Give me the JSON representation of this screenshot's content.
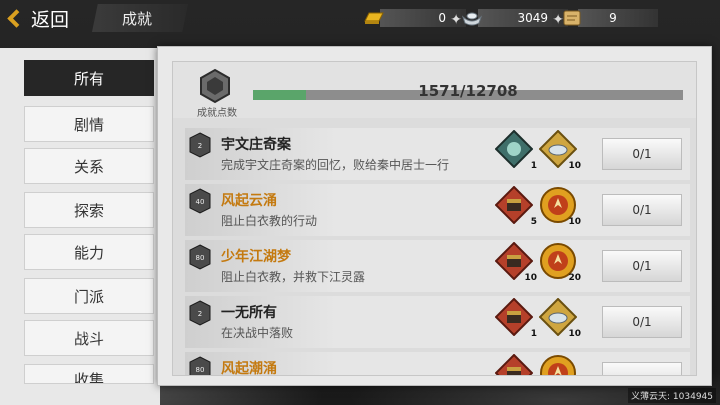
{
  "header": {
    "back_label": "返回",
    "title": "成就"
  },
  "currencies": [
    {
      "icon": "gold-ingot-icon",
      "value": "0"
    },
    {
      "icon": "silver-ingot-icon",
      "value": "3049"
    },
    {
      "icon": "scroll-icon",
      "value": "9"
    }
  ],
  "sidebar": {
    "items": [
      {
        "label": "所有",
        "active": true
      },
      {
        "label": "剧情"
      },
      {
        "label": "关系"
      },
      {
        "label": "探索"
      },
      {
        "label": "能力"
      },
      {
        "label": "门派"
      },
      {
        "label": "战斗"
      },
      {
        "label": "收集"
      }
    ]
  },
  "progress": {
    "label": "成就点数",
    "text": "1571/12708",
    "value": 1571,
    "max": 12708
  },
  "achievements": [
    {
      "level": "2",
      "title": "宇文庄奇案",
      "title_color": "#222222",
      "desc": "完成宇文庄奇案的回忆，败给秦中居士一行",
      "rewards": [
        {
          "icon": "teal-gem-icon",
          "count": "1"
        },
        {
          "icon": "silver-ingot-reward-icon",
          "count": "10"
        }
      ],
      "status": "0/1"
    },
    {
      "level": "40",
      "title": "风起云涌",
      "title_color": "#c47a10",
      "desc": "阻止白衣教的行动",
      "rewards": [
        {
          "icon": "red-chest-icon",
          "count": "5"
        },
        {
          "icon": "gold-coin-icon",
          "count": "10"
        }
      ],
      "status": "0/1"
    },
    {
      "level": "80",
      "title": "少年江湖梦",
      "title_color": "#c47a10",
      "desc": "阻止白衣教，并救下江灵露",
      "rewards": [
        {
          "icon": "red-chest-icon",
          "count": "10"
        },
        {
          "icon": "gold-coin-icon",
          "count": "20"
        }
      ],
      "status": "0/1"
    },
    {
      "level": "2",
      "title": "一无所有",
      "title_color": "#222222",
      "desc": "在决战中落败",
      "rewards": [
        {
          "icon": "red-chest-icon",
          "count": "1"
        },
        {
          "icon": "silver-ingot-reward-icon",
          "count": "10"
        }
      ],
      "status": "0/1"
    },
    {
      "level": "80",
      "title": "风起潮涌",
      "title_color": "#c47a10",
      "desc": "",
      "rewards": [
        {
          "icon": "red-chest-icon",
          "count": ""
        },
        {
          "icon": "gold-coin-icon",
          "count": ""
        }
      ],
      "status": ""
    }
  ],
  "watermark": "义薄云天: 1034945"
}
